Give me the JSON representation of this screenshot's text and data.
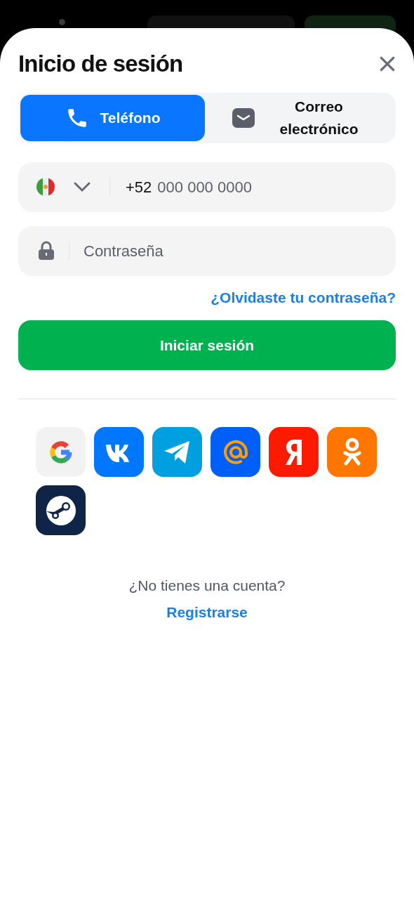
{
  "title": "Inicio de sesión",
  "tabs": [
    {
      "label": "Teléfono",
      "kind": "phone",
      "selected": true
    },
    {
      "label": "Correo electrónico",
      "kind": "mail",
      "selected": false
    }
  ],
  "phone_field": {
    "prefix": "+52",
    "placeholder": "000 000 0000"
  },
  "password_field": {
    "placeholder": "Contraseña"
  },
  "forgot_link": "¿Olvidaste tu contraseña?",
  "submit_button": "Iniciar sesión",
  "social_logins": [
    {
      "kind": "google",
      "color": "#f2f2f2"
    },
    {
      "kind": "vk",
      "color": "#0077ff"
    },
    {
      "kind": "telegram",
      "color": "#00a0e0"
    },
    {
      "kind": "mail",
      "color": "#005ff9"
    },
    {
      "kind": "yandex",
      "color": "#fc1a00"
    },
    {
      "kind": "ok",
      "color": "#ff7700"
    },
    {
      "kind": "steam",
      "color": "#0e2547"
    }
  ],
  "signup_prompt": "¿No tienes una cuenta?",
  "signup_link": "Registrarse"
}
